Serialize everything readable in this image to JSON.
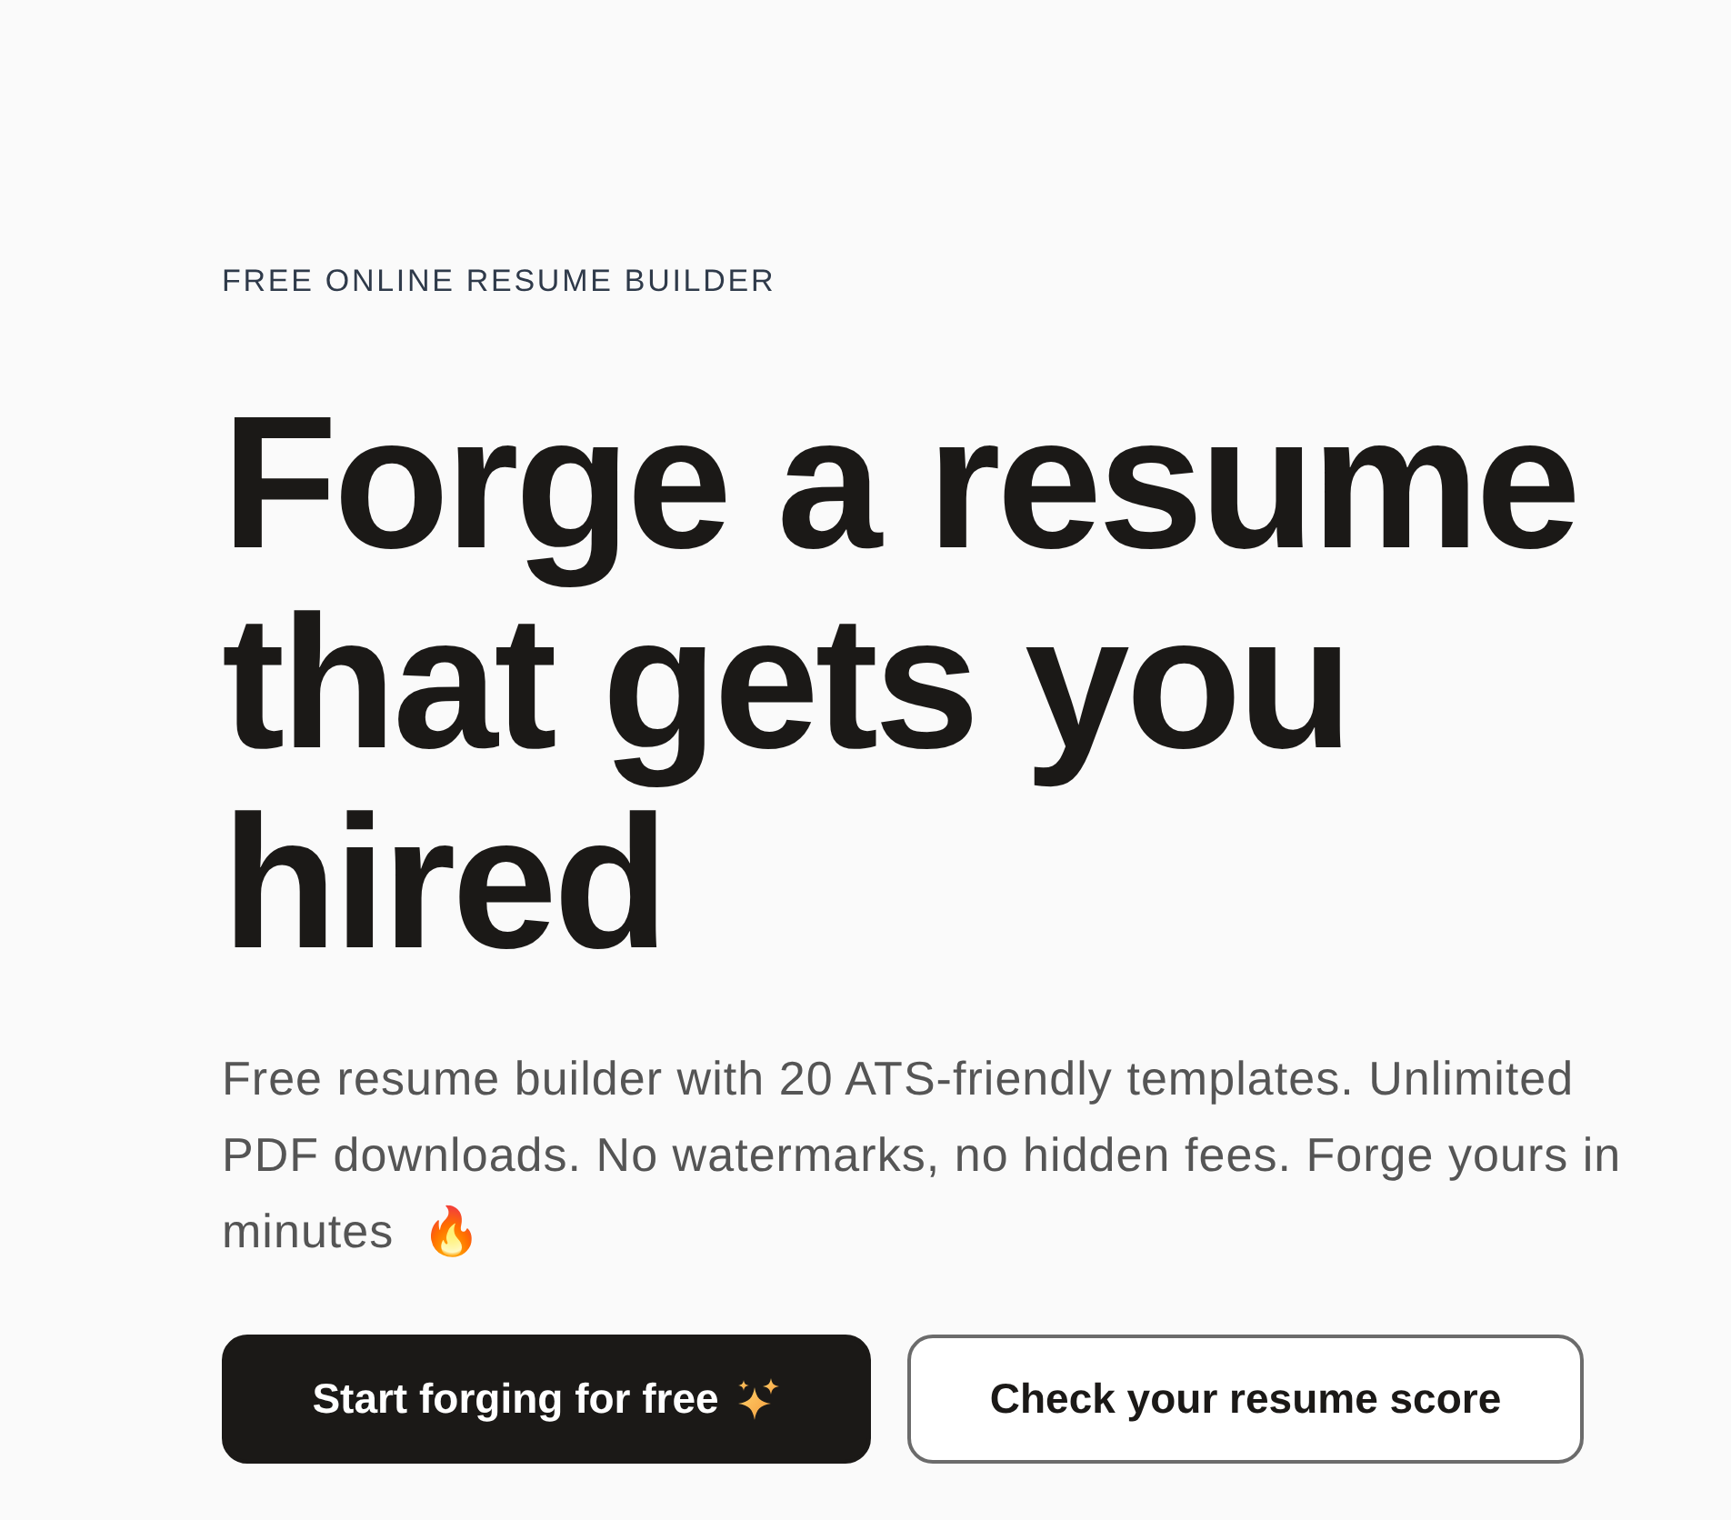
{
  "hero": {
    "eyebrow": "FREE ONLINE RESUME BUILDER",
    "headline": "Forge a resume that gets you hired",
    "description": "Free resume builder with 20 ATS-friendly templates. Unlimited PDF downloads. No watermarks, no hidden fees. Forge yours in minutes  🔥",
    "actions": [
      {
        "label": "Start forging for free",
        "kind": "primary"
      },
      {
        "label": "Check your resume score",
        "kind": "secondary"
      }
    ]
  }
}
